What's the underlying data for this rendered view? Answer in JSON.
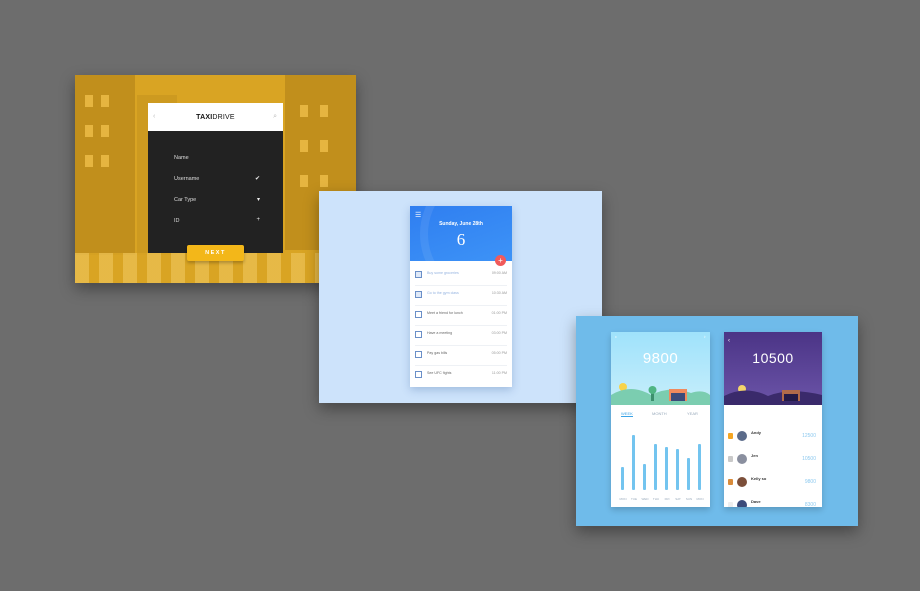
{
  "taxi": {
    "logo_bold": "TAXI",
    "logo_light": "DRIVE",
    "back_icon": "‹",
    "search_icon": "⌕",
    "fields": [
      {
        "label": "Name",
        "mark": ""
      },
      {
        "label": "Username",
        "mark": "✔"
      },
      {
        "label": "Car Type",
        "mark": "▾"
      },
      {
        "label": "ID",
        "mark": "+"
      }
    ],
    "next_label": "NEXT",
    "accent": "#f3b719"
  },
  "todo": {
    "menu_icon": "☰",
    "date": "Sunday, June 28th",
    "day": "6",
    "fab_icon": "+",
    "items": [
      {
        "title": "Buy some groceries",
        "time": "09:00 AM",
        "done": true
      },
      {
        "title": "Go to the gym class",
        "time": "10:30 AM",
        "done": true
      },
      {
        "title": "Meet a friend for lunch",
        "time": "01:00 PM",
        "done": false
      },
      {
        "title": "Have a meeting",
        "time": "03:00 PM",
        "done": false
      },
      {
        "title": "Pay gas bills",
        "time": "05:00 PM",
        "done": false
      },
      {
        "title": "See UFC fights",
        "time": "11:00 PM",
        "done": false
      }
    ],
    "accent": "#2f7ef0"
  },
  "steps": {
    "today_count": "9800",
    "friend_count": "10500",
    "tabs": [
      "WEEK",
      "MONTH",
      "YEAR"
    ],
    "chart_data": {
      "type": "bar",
      "categories": [
        "MON",
        "TUE",
        "WED",
        "THU",
        "FRI",
        "SAT",
        "SUN",
        "MON"
      ],
      "values": [
        40,
        95,
        45,
        80,
        75,
        70,
        55,
        80
      ],
      "ylim": [
        0,
        100
      ]
    },
    "leaderboard": [
      {
        "name": "Andy",
        "steps": "12500",
        "rank_color": "#f5a623",
        "avatar_color": "#5b6b8a"
      },
      {
        "name": "Jen",
        "steps": "10500",
        "rank_color": "#c9c9c9",
        "avatar_color": "#8a8f9f"
      },
      {
        "name": "Kelly so",
        "steps": "9800",
        "rank_color": "#d98b3a",
        "avatar_color": "#7c4f3a"
      },
      {
        "name": "Dave",
        "steps": "8300",
        "rank_color": "#eeeeee",
        "avatar_color": "#3c4b7a"
      }
    ],
    "accent": "#3aa3e6"
  }
}
